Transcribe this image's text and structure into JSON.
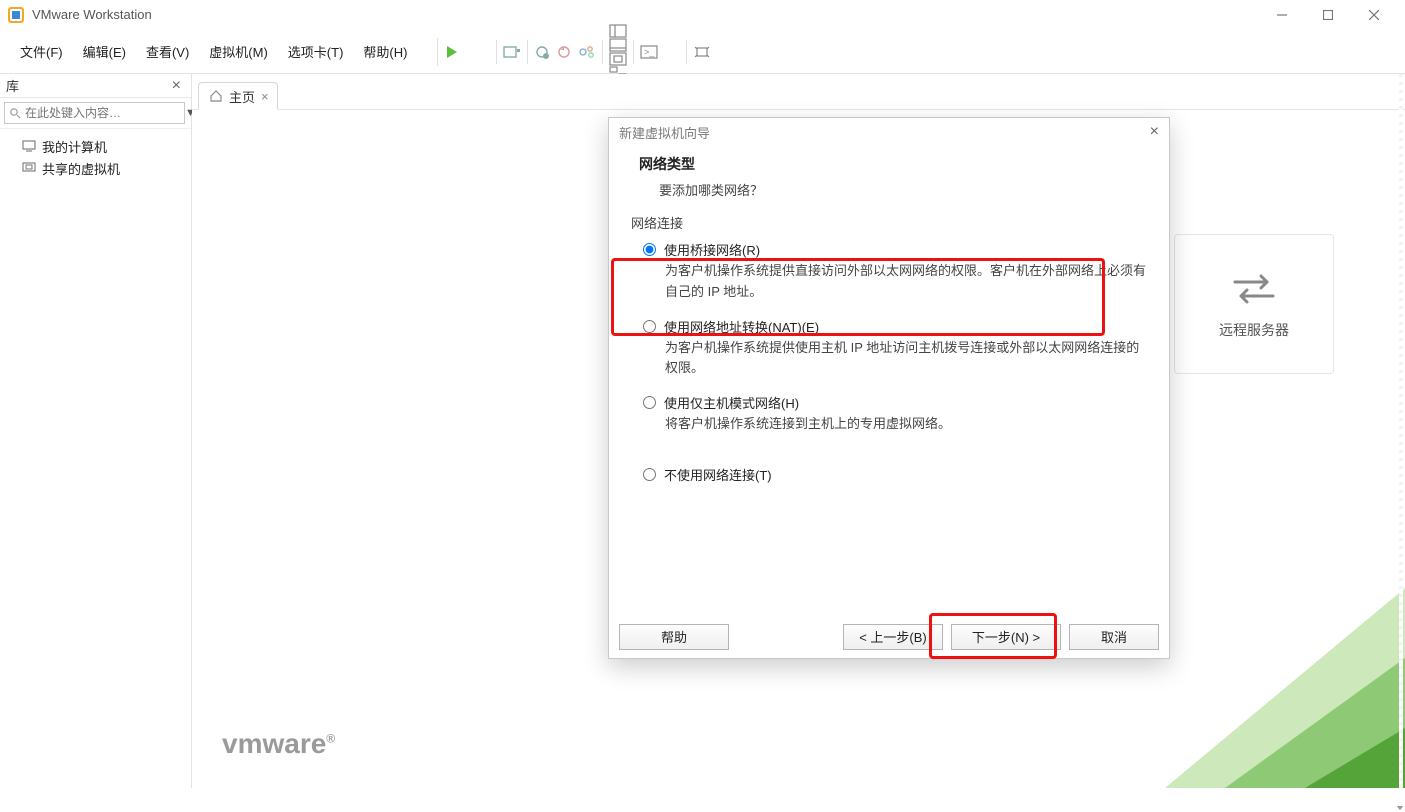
{
  "app": {
    "title": "VMware Workstation"
  },
  "menu": {
    "file": "文件(F)",
    "edit": "编辑(E)",
    "view": "查看(V)",
    "vm": "虚拟机(M)",
    "tabs": "选项卡(T)",
    "help": "帮助(H)"
  },
  "sidebar": {
    "title": "库",
    "search_placeholder": "在此处键入内容…",
    "items": [
      {
        "label": "我的计算机"
      },
      {
        "label": "共享的虚拟机"
      }
    ]
  },
  "tab": {
    "home": "主页"
  },
  "bgcard": {
    "label": "远程服务器"
  },
  "watermark": "vmware",
  "dialog": {
    "title": "新建虚拟机向导",
    "heading": "网络类型",
    "subheading": "要添加哪类网络？",
    "group_label": "网络连接",
    "options": [
      {
        "label": "使用桥接网络(R)",
        "desc": "为客户机操作系统提供直接访问外部以太网网络的权限。客户机在外部网络上必须有自己的 IP 地址。"
      },
      {
        "label": "使用网络地址转换(NAT)(E)",
        "desc": "为客户机操作系统提供使用主机 IP 地址访问主机拨号连接或外部以太网网络连接的权限。"
      },
      {
        "label": "使用仅主机模式网络(H)",
        "desc": "将客户机操作系统连接到主机上的专用虚拟网络。"
      },
      {
        "label": "不使用网络连接(T)",
        "desc": ""
      }
    ],
    "buttons": {
      "help": "帮助",
      "back": "< 上一步(B)",
      "next": "下一步(N) >",
      "cancel": "取消"
    }
  }
}
